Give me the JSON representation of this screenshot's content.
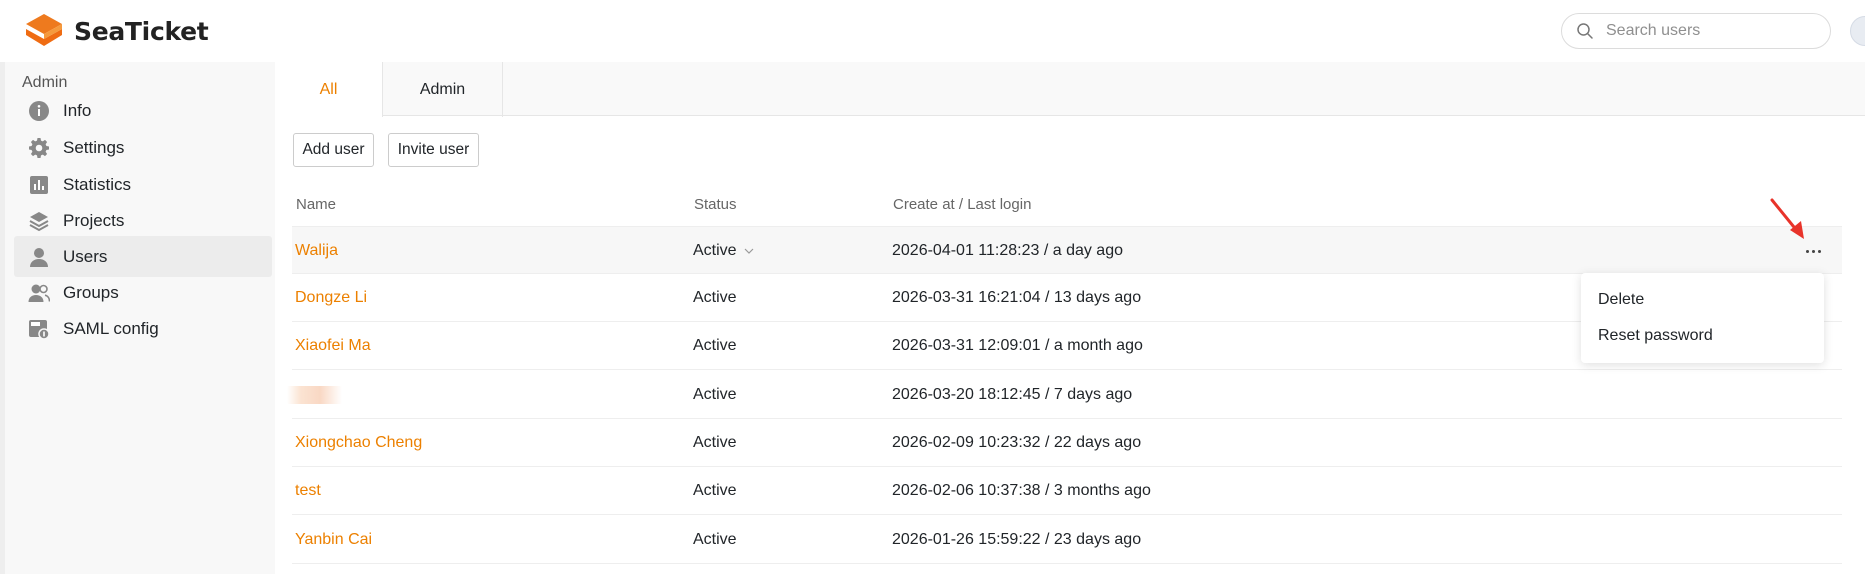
{
  "app": {
    "name": "SeaTicket",
    "brand_color": "#ec8000"
  },
  "header": {
    "search_placeholder": "Search users",
    "search_icon": "search-icon",
    "avatar_icon": "user-avatar"
  },
  "sidebar": {
    "title": "Admin",
    "items": [
      {
        "label": "Info",
        "icon": "info-icon"
      },
      {
        "label": "Settings",
        "icon": "gear-icon"
      },
      {
        "label": "Statistics",
        "icon": "bar-chart-icon"
      },
      {
        "label": "Projects",
        "icon": "layers-icon"
      },
      {
        "label": "Users",
        "icon": "user-icon",
        "active": true
      },
      {
        "label": "Groups",
        "icon": "users-icon"
      },
      {
        "label": "SAML config",
        "icon": "saml-icon"
      }
    ]
  },
  "main": {
    "tabs": [
      {
        "label": "All",
        "active": true
      },
      {
        "label": "Admin"
      }
    ],
    "actions": {
      "add_user": "Add user",
      "invite_user": "Invite user"
    },
    "table": {
      "columns": {
        "name": "Name",
        "status": "Status",
        "created": "Create at / Last login"
      },
      "rows": [
        {
          "name": "Walija",
          "status": "Active",
          "created": "2026-04-01 11:28:23 / a day ago"
        },
        {
          "name": "Dongze Li",
          "status": "Active",
          "created": "2026-03-31 16:21:04 / 13 days ago"
        },
        {
          "name": "Xiaofei Ma",
          "status": "Active",
          "created": "2026-03-31 12:09:01 / a month ago"
        },
        {
          "name": "",
          "status": "Active",
          "created": "2026-03-20 18:12:45 / 7 days ago"
        },
        {
          "name": "Xiongchao Cheng",
          "status": "Active",
          "created": "2026-02-09 10:23:32 / 22 days ago"
        },
        {
          "name": "test",
          "status": "Active",
          "created": "2026-02-06 10:37:38 / 3 months ago"
        },
        {
          "name": "Yanbin Cai",
          "status": "Active",
          "created": "2026-01-26 15:59:22 / 23 days ago"
        }
      ]
    },
    "row_menu": {
      "delete": "Delete",
      "reset_password": "Reset password"
    }
  }
}
